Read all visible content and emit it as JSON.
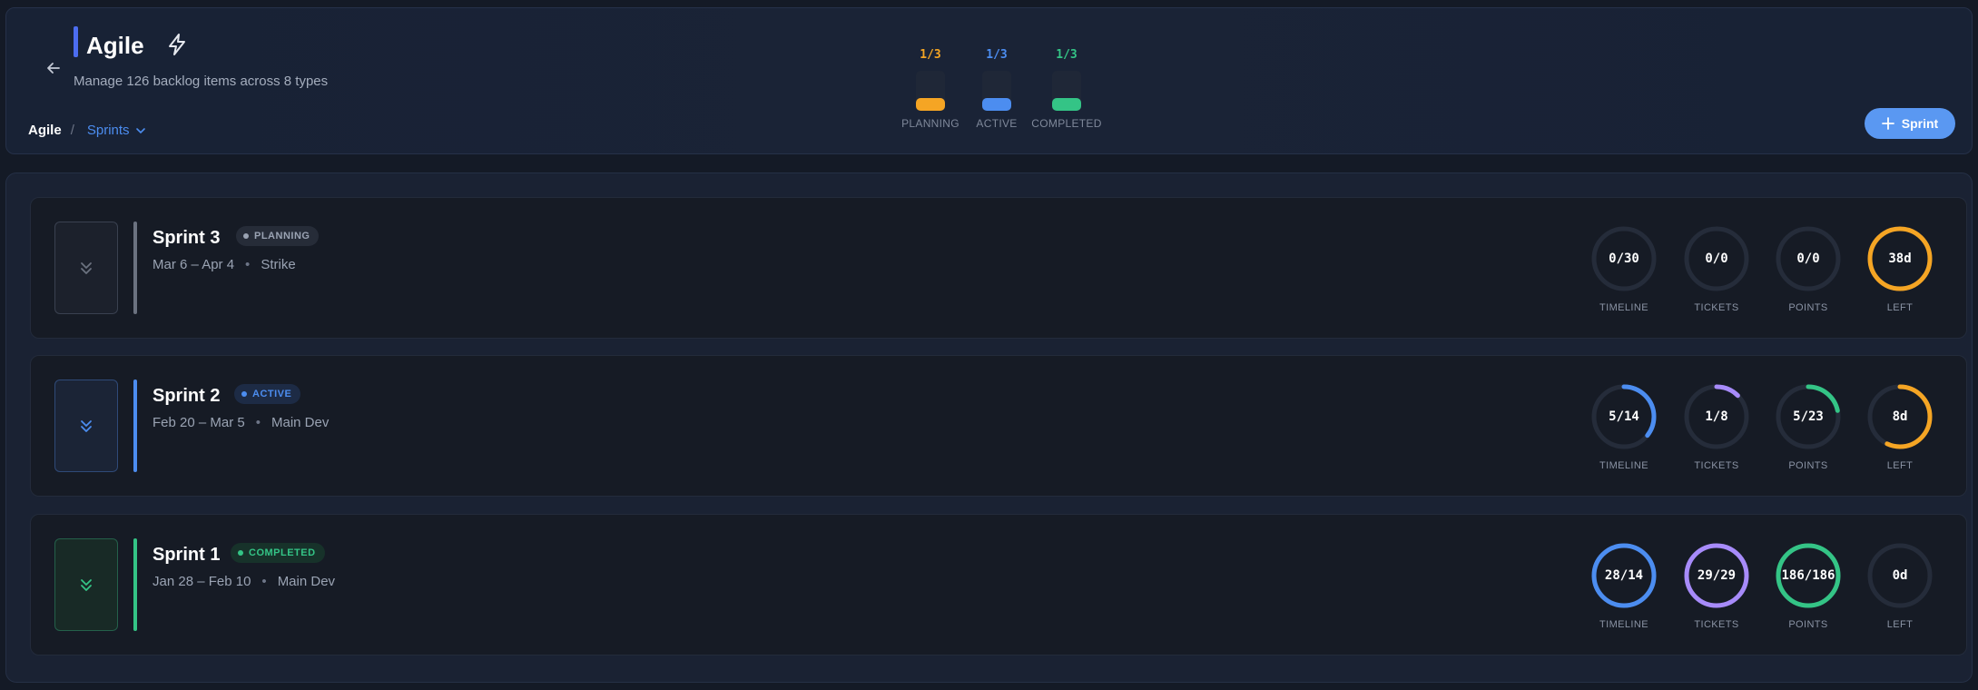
{
  "header": {
    "title": "Agile",
    "subtitle": "Manage 126 backlog items across 8 types",
    "breadcrumb": {
      "root": "Agile",
      "separator": "/",
      "current": "Sprints"
    },
    "add_button": "Sprint"
  },
  "stats": [
    {
      "value": "1/3",
      "label": "PLANNING",
      "color": "#f5a524"
    },
    {
      "value": "1/3",
      "label": "ACTIVE",
      "color": "#4c8df0"
    },
    {
      "value": "1/3",
      "label": "COMPLETED",
      "color": "#34c486"
    }
  ],
  "sprints": [
    {
      "name": "Sprint 3",
      "status": "PLANNING",
      "status_color": "#9aa3b3",
      "accent": "#6b7280",
      "dates": "Mar 6 – Apr 4",
      "team": "Strike",
      "metrics": [
        {
          "value": "0/30",
          "label": "TIMELINE",
          "progress": 0,
          "color": "#4c8df0"
        },
        {
          "value": "0/0",
          "label": "TICKETS",
          "progress": 0,
          "color": "#a78bfa"
        },
        {
          "value": "0/0",
          "label": "POINTS",
          "progress": 0,
          "color": "#34c486"
        },
        {
          "value": "38d",
          "label": "LEFT",
          "progress": 1,
          "color": "#f5a524"
        }
      ]
    },
    {
      "name": "Sprint 2",
      "status": "ACTIVE",
      "status_color": "#4c8df0",
      "accent": "#4c8df0",
      "dates": "Feb 20 – Mar 5",
      "team": "Main Dev",
      "metrics": [
        {
          "value": "5/14",
          "label": "TIMELINE",
          "progress": 0.357,
          "color": "#4c8df0"
        },
        {
          "value": "1/8",
          "label": "TICKETS",
          "progress": 0.125,
          "color": "#a78bfa"
        },
        {
          "value": "5/23",
          "label": "POINTS",
          "progress": 0.217,
          "color": "#34c486"
        },
        {
          "value": "8d",
          "label": "LEFT",
          "progress": 0.57,
          "color": "#f5a524"
        }
      ]
    },
    {
      "name": "Sprint 1",
      "status": "COMPLETED",
      "status_color": "#34c486",
      "accent": "#34c486",
      "dates": "Jan 28 – Feb 10",
      "team": "Main Dev",
      "metrics": [
        {
          "value": "28/14",
          "label": "TIMELINE",
          "progress": 1,
          "color": "#4c8df0"
        },
        {
          "value": "29/29",
          "label": "TICKETS",
          "progress": 1,
          "color": "#a78bfa"
        },
        {
          "value": "186/186",
          "label": "POINTS",
          "progress": 1,
          "color": "#34c486"
        },
        {
          "value": "0d",
          "label": "LEFT",
          "progress": 0,
          "color": "#f5a524"
        }
      ]
    }
  ]
}
